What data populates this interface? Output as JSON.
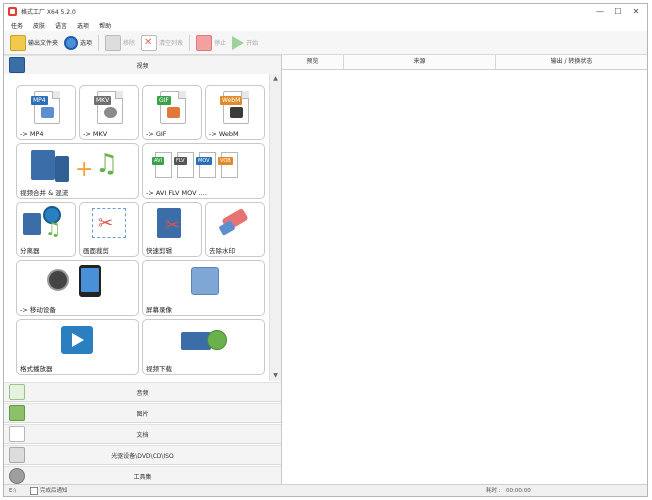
{
  "window": {
    "title": "格式工厂 X64 5.2.0"
  },
  "menu": [
    "任务",
    "皮肤",
    "语言",
    "选项",
    "帮助"
  ],
  "toolbar": {
    "output_folder": "输出文件夹",
    "options": "选项",
    "remove": "移除",
    "clear_list": "清空列表",
    "stop": "停止",
    "start": "开始"
  },
  "categories": {
    "video": "视频",
    "audio": "音频",
    "image": "图片",
    "document": "文档",
    "rom": "光驱设备\\DVD\\CD\\ISO",
    "toolbox": "工具集"
  },
  "tiles": {
    "mp4": {
      "label": "-> MP4",
      "tag": "MP4"
    },
    "mkv": {
      "label": "-> MKV",
      "tag": "MKV"
    },
    "gif": {
      "label": "-> GIF",
      "tag": "GIF"
    },
    "webm": {
      "label": "-> WebM",
      "tag": "WebM"
    },
    "merge": {
      "label": "视频合并 & 混流"
    },
    "avi_flv": {
      "label": "-> AVI FLV MOV ....",
      "tags": [
        "AVI",
        "FLV",
        "MOV",
        "VOB"
      ]
    },
    "splitter": {
      "label": "分离器"
    },
    "crop": {
      "label": "画面裁剪"
    },
    "quick_clip": {
      "label": "快速剪辑"
    },
    "watermark": {
      "label": "去除水印"
    },
    "mobile": {
      "label": "-> 移动设备"
    },
    "screen_record": {
      "label": "屏幕录像"
    },
    "player": {
      "label": "格式播放器"
    },
    "download": {
      "label": "视频下载"
    }
  },
  "list_columns": [
    "预览",
    "来源",
    "输出 / 转换状态"
  ],
  "status": {
    "left": "E:\\",
    "notify": "完成后通知",
    "elapsed_label": "耗时 :",
    "elapsed": "00:00:00"
  },
  "colors": {
    "mp4_tag": "#2d6fb5",
    "mkv_tag": "#6f6f6f",
    "gif_tag": "#3aa34a",
    "webm_tag": "#e08a2a",
    "accent": "#4a90d9"
  }
}
